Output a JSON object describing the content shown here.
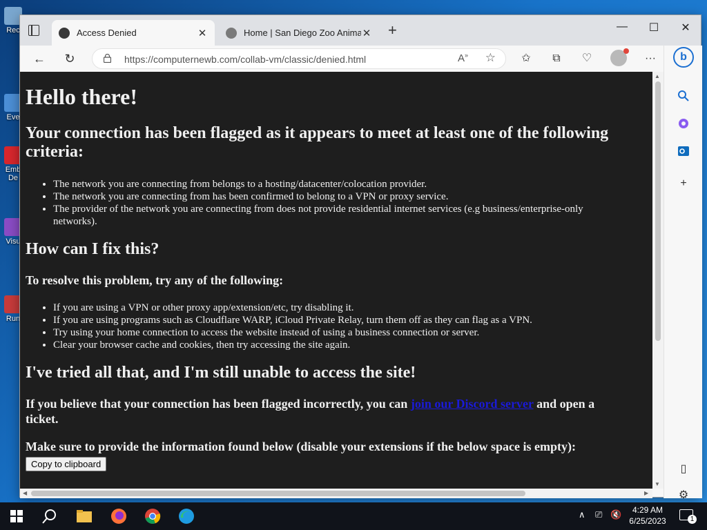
{
  "desktop": {
    "icons": [
      {
        "label": "Rec",
        "color": "#7aa7cf"
      },
      {
        "label": "Eve",
        "color": "#4c8fd6"
      },
      {
        "label": "Emb",
        "color": "#d8272d"
      },
      {
        "label": "De",
        "color": "#d8272d"
      },
      {
        "label": "Visu",
        "color": "#8a4cc5"
      },
      {
        "label": "Run",
        "color": "#c73b3b"
      }
    ]
  },
  "browser": {
    "tabs": [
      {
        "title": "Access Denied",
        "active": true
      },
      {
        "title": "Home | San Diego Zoo Animals &",
        "active": false
      }
    ],
    "window_controls": {
      "minimize": "—",
      "maximize": "☐",
      "close": "✕"
    },
    "address_bar": {
      "url": "https://computernewb.com/collab-vm/classic/denied.html"
    },
    "sidebar_icons": [
      "search-icon",
      "copilot-icon",
      "outlook-icon",
      "add-icon",
      "split-screen-icon",
      "settings-icon"
    ]
  },
  "page": {
    "heading": "Hello there!",
    "flagged_heading": "Your connection has been flagged as it appears to meet at least one of the following criteria:",
    "criteria": [
      "The network you are connecting from belongs to a hosting/datacenter/colocation provider.",
      "The network you are connecting from has been confirmed to belong to a VPN or proxy service.",
      "The provider of the network you are connecting from does not provide residential internet services (e.g business/enterprise-only networks)."
    ],
    "fix_heading": "How can I fix this?",
    "resolve_intro": "To resolve this problem, try any of the following:",
    "fixes": [
      "If you are using a VPN or other proxy app/extension/etc, try disabling it.",
      "If you are using programs such as Cloudflare WARP, iCloud Private Relay, turn them off as they can flag as a VPN.",
      "Try using your home connection to access the website instead of using a business connection or server.",
      "Clear your browser cache and cookies, then try accessing the site again."
    ],
    "tried_heading": "I've tried all that, and I'm still unable to access the site!",
    "ticket_text_before": "If you believe that your connection has been flagged incorrectly, you can ",
    "ticket_link": "join our Discord server",
    "ticket_text_after": " and open a ticket.",
    "info_text": "Make sure to provide the information found below (disable your extensions if the below space is empty):",
    "copy_button": "Copy to clipboard"
  },
  "taskbar": {
    "time": "4:29 AM",
    "date": "6/25/2023",
    "notification_count": "1",
    "apps": [
      "file-explorer-icon",
      "firefox-icon",
      "chrome-icon",
      "edge-icon"
    ]
  }
}
